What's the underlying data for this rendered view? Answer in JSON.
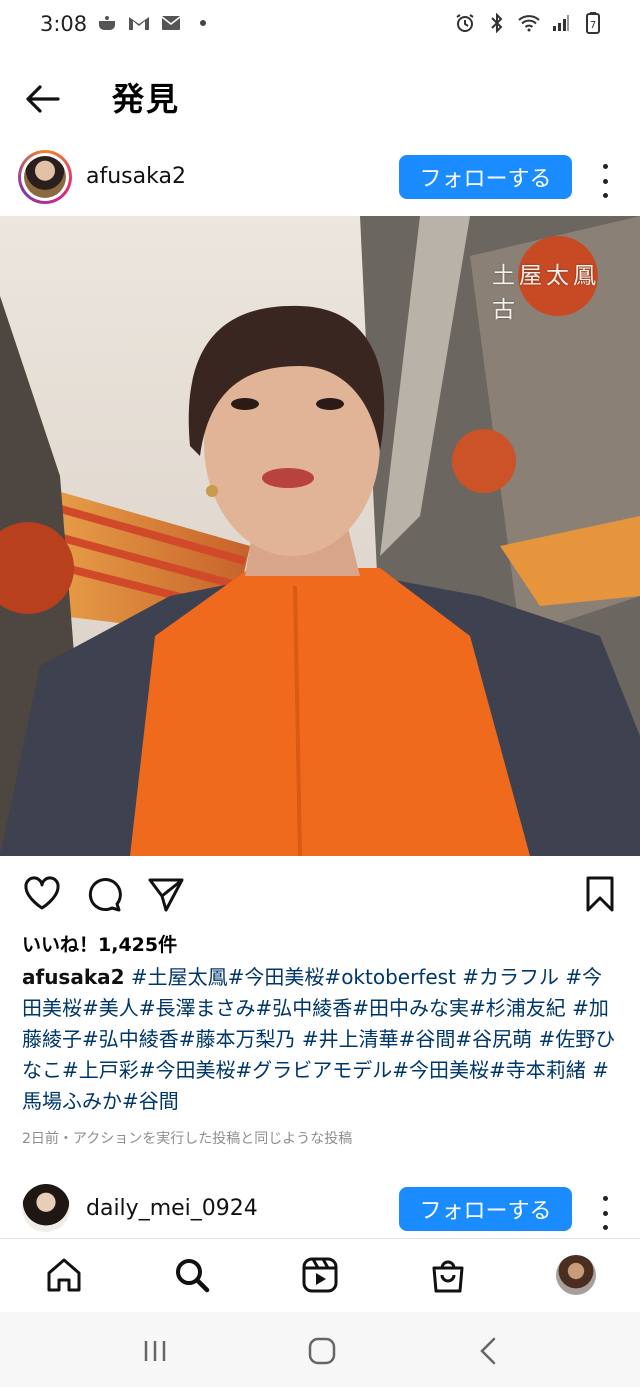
{
  "status_bar": {
    "time": "3:08",
    "left_icons": [
      "cooking-pot-icon",
      "gmail-icon",
      "au-mail-icon",
      "notification-dot-icon"
    ],
    "right_icons": [
      "alarm-icon",
      "bluetooth-icon",
      "wifi-icon",
      "signal-icon",
      "battery-icon"
    ],
    "battery_level": "7"
  },
  "topbar": {
    "title": "発見",
    "back_icon": "back-arrow-icon"
  },
  "post": {
    "username": "afusaka2",
    "follow_label": "フォローする",
    "image_overlay_text": "土屋太鳳　古",
    "likes": "いいね！1,425件",
    "caption_user": "afusaka2",
    "caption_text": " #土屋太鳳#今田美桜#oktoberfest #カラフル #今田美桜#美人#長澤まさみ#弘中綾香#田中みな実#杉浦友紀 #加藤綾子#弘中綾香#藤本万梨乃 #井上清華#谷間#谷尻萌 #佐野ひなこ#上戸彩#今田美桜#グラビアモデル#今田美桜#寺本莉緒 #馬場ふみか#谷間",
    "meta": "2日前・アクションを実行した投稿と同じような投稿"
  },
  "next_post": {
    "username": "daily_mei_0924",
    "follow_label": "フォローする"
  },
  "colors": {
    "follow_button": "#1a8cff",
    "caption_link": "#00376b",
    "meta_text": "#8e8e8e"
  },
  "bottom_nav": [
    "home-icon",
    "search-icon",
    "reels-icon",
    "shop-icon",
    "profile-avatar"
  ],
  "system_nav": [
    "recents-icon",
    "home-circle-icon",
    "system-back-icon"
  ]
}
